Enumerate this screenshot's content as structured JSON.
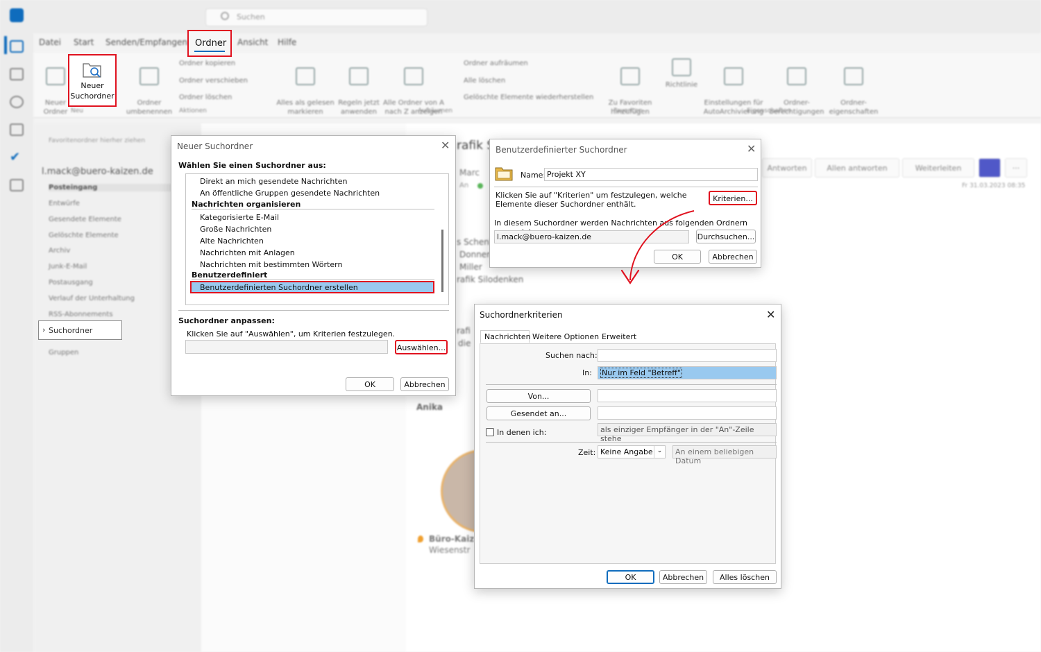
{
  "app": {
    "search_placeholder": "Suchen",
    "menu": [
      "Datei",
      "Start",
      "Senden/Empfangen",
      "Ordner",
      "Ansicht",
      "Hilfe"
    ],
    "ribbon": {
      "neuer_ordner": "Neuer\nOrdner",
      "neuer_suchordner": "Neuer\nSuchordner",
      "grp_neu": "Neu",
      "ordner_umbenennen": "Ordner\numbenennen",
      "ordner_kopieren": "Ordner kopieren",
      "ordner_verschieben": "Ordner verschieben",
      "ordner_loeschen": "Ordner löschen",
      "grp_aktionen": "Aktionen",
      "alles_gelesen": "Alles als gelesen\nmarkieren",
      "regeln": "Regeln jetzt\nanwenden",
      "alle_ordner": "Alle Ordner von A\nnach Z anzeigen",
      "ordner_aufraeumen": "Ordner aufräumen",
      "alle_loeschen": "Alle löschen",
      "geloeschte": "Gelöschte Elemente wiederherstellen",
      "grp_aufraeumen": "Aufräumen",
      "zu_favoriten": "Zu Favoriten\nhinzufügen",
      "grp_favoriten": "Favoriten",
      "richtlinie": "Richtlinie",
      "autoarchiv": "Einstellungen für\nAutoArchivierung",
      "berechtigungen": "Ordner-\nberechtigungen",
      "eigenschaften": "Ordner-\neigenschaften",
      "grp_eigenschaften": "Eigenschaften"
    },
    "sidebar": {
      "favorites_hint": "Favoritenordner hierher ziehen",
      "account": "l.mack@buero-kaizen.de",
      "items": [
        "Posteingang",
        "Entwürfe",
        "Gesendete Elemente",
        "Gelöschte Elemente",
        "Archiv",
        "Junk-E-Mail",
        "Postausgang",
        "Verlauf der Unterhaltung",
        "RSS-Abonnements",
        "Suchordner",
        "Gruppen"
      ]
    },
    "reading": {
      "subject_fragment": "rafik S",
      "sender_fragment": "Marc",
      "an_label": "An",
      "antworten": "Antworten",
      "allen_antworten": "Allen antworten",
      "weiterleiten": "Weiterleiten",
      "date": "Fr 31.03.2023 08:35",
      "body1": "s Schenk",
      "body2": "Donner",
      "body3": "Miller",
      "body4": "rafik Silodenken",
      "body5": "rafi",
      "body6": "die",
      "sig_name": "Anika",
      "sig_company": "Büro-Kaiz",
      "sig_place": "Wiesenstr"
    }
  },
  "dlg_neuer": {
    "title": "Neuer Suchordner",
    "prompt": "Wählen Sie einen Suchordner aus:",
    "items_top": [
      "Direkt an mich gesendete Nachrichten",
      "An öffentliche Gruppen gesendete Nachrichten"
    ],
    "head_organisieren": "Nachrichten organisieren",
    "items_org": [
      "Kategorisierte E-Mail",
      "Große Nachrichten",
      "Alte Nachrichten",
      "Nachrichten mit Anlagen",
      "Nachrichten mit bestimmten Wörtern"
    ],
    "head_benutzer": "Benutzerdefiniert",
    "selected_item": "Benutzerdefinierten Suchordner erstellen",
    "anpassen_label": "Suchordner anpassen:",
    "anpassen_hint": "Klicken Sie auf \"Auswählen\", um Kriterien festzulegen.",
    "auswaehlen": "Auswählen...",
    "ok": "OK",
    "abbrechen": "Abbrechen"
  },
  "dlg_benutzer": {
    "title": "Benutzerdefinierter Suchordner",
    "name_label": "Name:",
    "name_value": "Projekt XY",
    "kriterien_hint": "Klicken Sie auf \"Kriterien\" um festzulegen, welche Elemente dieser Suchordner enthält.",
    "kriterien": "Kriterien...",
    "ordner_hint": "In diesem Suchordner werden Nachrichten aus folgenden Ordnern angezeigt:",
    "ordner_value": "l.mack@buero-kaizen.de",
    "durchsuchen": "Durchsuchen...",
    "ok": "OK",
    "abbrechen": "Abbrechen"
  },
  "dlg_kriterien": {
    "title": "Suchordnerkriterien",
    "tabs": [
      "Nachrichten",
      "Weitere Optionen",
      "Erweitert"
    ],
    "suchen_nach": "Suchen nach:",
    "in_label": "In:",
    "in_value": "Nur im Feld \"Betreff\"",
    "von": "Von...",
    "gesendet_an": "Gesendet an...",
    "in_denen_ich": "In denen ich:",
    "empfaenger_value": "als einziger Empfänger in der \"An\"-Zeile stehe",
    "zeit_label": "Zeit:",
    "zeit_value": "Keine Angabe",
    "datum_value": "An einem beliebigen Datum",
    "ok": "OK",
    "abbrechen": "Abbrechen",
    "alles_loeschen": "Alles löschen"
  },
  "colors": {
    "highlight": "#e0121f",
    "selection": "#99c9ef",
    "accent": "#0f6cbd"
  }
}
